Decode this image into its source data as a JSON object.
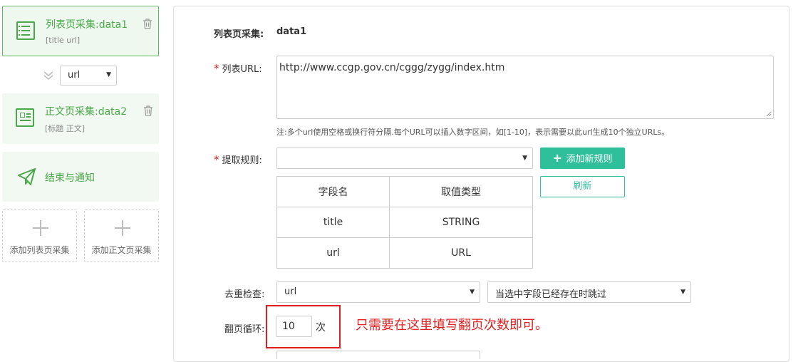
{
  "sidebar": {
    "list_card": {
      "title": "列表页采集:data1",
      "fields": "[title url]"
    },
    "connector_select": {
      "value": "url"
    },
    "detail_card": {
      "title": "正文页采集:data2",
      "fields": "[标题 正文]"
    },
    "end_card": {
      "title": "结束与通知"
    },
    "add_list_label": "添加列表页采集",
    "add_detail_label": "添加正文页采集"
  },
  "form": {
    "name_label": "列表页采集:",
    "name_value": "data1",
    "url_label": "列表URL:",
    "url_value": "http://www.ccgp.gov.cn/cggg/zygg/index.htm",
    "url_note": "注:多个url使用空格或换行符分隔.每个URL可以插入数字区间，如[1-10]，表示需要以此url生成10个独立URLs。",
    "rule_label": "提取规则:",
    "rule_value": "",
    "add_rule_button": "添加新规则",
    "refresh_button": "刷新",
    "table": {
      "headers": [
        "字段名",
        "取值类型"
      ],
      "rows": [
        [
          "title",
          "STRING"
        ],
        [
          "url",
          "URL"
        ]
      ]
    },
    "dedup_label": "去重检查:",
    "dedup_field": "url",
    "dedup_policy": "当选中字段已经存在时跳过",
    "page_label": "翻页循环:",
    "page_value": "10",
    "page_unit": "次",
    "annotation": "只需要在这里填写翻页次数即可。"
  },
  "colors": {
    "accent_green": "#4aa84a",
    "button_teal": "#2fbf9b",
    "required_red": "#e02020"
  }
}
